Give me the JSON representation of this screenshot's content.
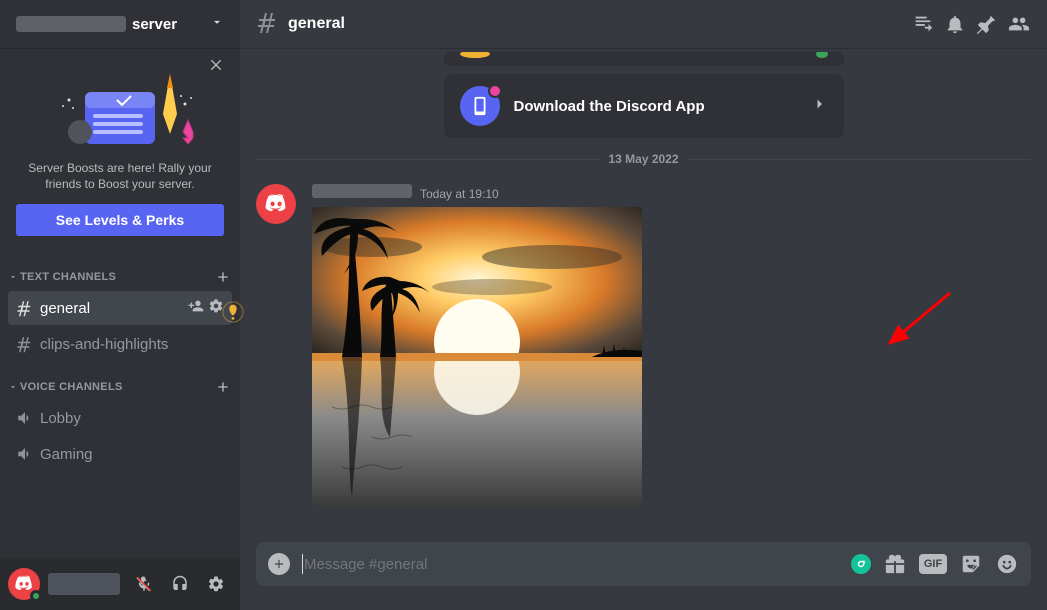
{
  "server": {
    "name_suffix": "server"
  },
  "boost": {
    "description": "Server Boosts are here! Rally your friends to Boost your server.",
    "button": "See Levels & Perks"
  },
  "sections": {
    "text_label": "TEXT CHANNELS",
    "voice_label": "VOICE CHANNELS"
  },
  "channels": {
    "text": [
      {
        "name": "general",
        "active": true
      },
      {
        "name": "clips-and-highlights",
        "active": false
      }
    ],
    "voice": [
      {
        "name": "Lobby"
      },
      {
        "name": "Gaming"
      }
    ]
  },
  "header": {
    "channel": "general"
  },
  "cards": {
    "download": "Download the Discord App"
  },
  "divider_date": "13 May 2022",
  "message": {
    "timestamp": "Today at 19:10"
  },
  "composer": {
    "placeholder": "Message #general",
    "gif_label": "GIF"
  }
}
